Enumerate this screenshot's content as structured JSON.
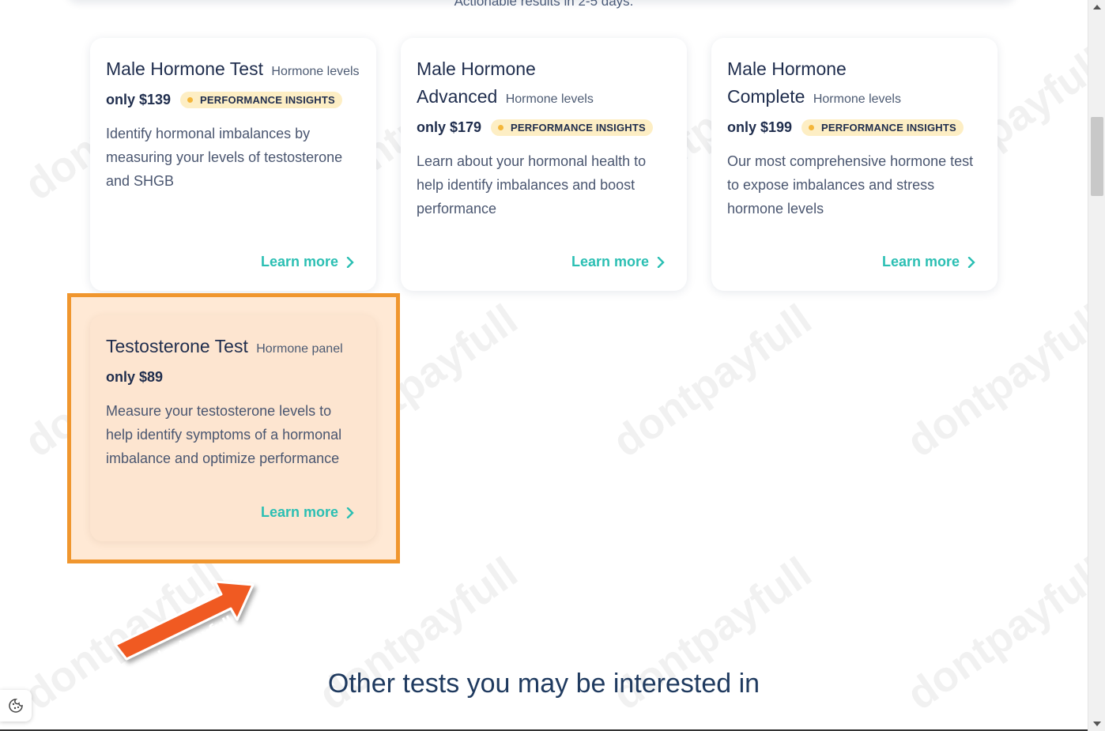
{
  "tagline": "Actionable results in 2-5 days.",
  "cards": [
    {
      "title": "Male Hormone Test",
      "subtitle": "Hormone levels",
      "price": "only $139",
      "badge": "PERFORMANCE INSIGHTS",
      "description": "Identify hormonal imbalances by measuring your levels of testosterone and SHGB",
      "link": "Learn more"
    },
    {
      "title": "Male Hormone Advanced",
      "subtitle": "Hormone levels",
      "price": "only $179",
      "badge": "PERFORMANCE INSIGHTS",
      "description": "Learn about your hormonal health to help identify imbalances and boost performance",
      "link": "Learn more"
    },
    {
      "title": "Male Hormone Complete",
      "subtitle": "Hormone levels",
      "price": "only $199",
      "badge": "PERFORMANCE INSIGHTS",
      "description": "Our most comprehensive hormone test to expose imbalances and stress hormone levels",
      "link": "Learn more"
    },
    {
      "title": "Testosterone Test",
      "subtitle": "Hormone panel",
      "price": "only $89",
      "description": "Measure your testosterone levels to help identify symptoms of a hormonal imbalance and optimize performance",
      "link": "Learn more"
    }
  ],
  "other_heading": "Other tests you may be interested in",
  "watermark_text": "dontpayfull",
  "arrow_label": "dontpayfull",
  "colors": {
    "accent": "#2bbfb3",
    "highlight_border": "#f0962e",
    "badge_bg": "#fdeec4",
    "arrow": "#f05a22"
  }
}
